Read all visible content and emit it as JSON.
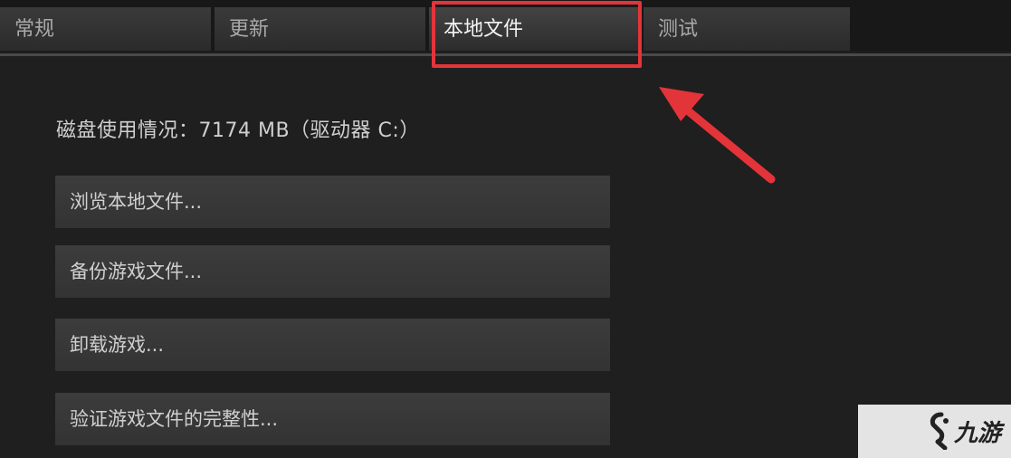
{
  "tabs": [
    {
      "label": "常规",
      "active": false
    },
    {
      "label": "更新",
      "active": false
    },
    {
      "label": "本地文件",
      "active": true
    },
    {
      "label": "测试",
      "active": false
    }
  ],
  "disk_usage": "磁盘使用情况：7174 MB（驱动器 C:）",
  "actions": {
    "browse": "浏览本地文件...",
    "backup": "备份游戏文件...",
    "uninstall": "卸载游戏...",
    "verify": "验证游戏文件的完整性..."
  },
  "annotation": {
    "color": "#e3343a",
    "highlighted_tab": "本地文件"
  },
  "watermark": {
    "text": "九游",
    "icon": "nine-game-logo-icon"
  }
}
